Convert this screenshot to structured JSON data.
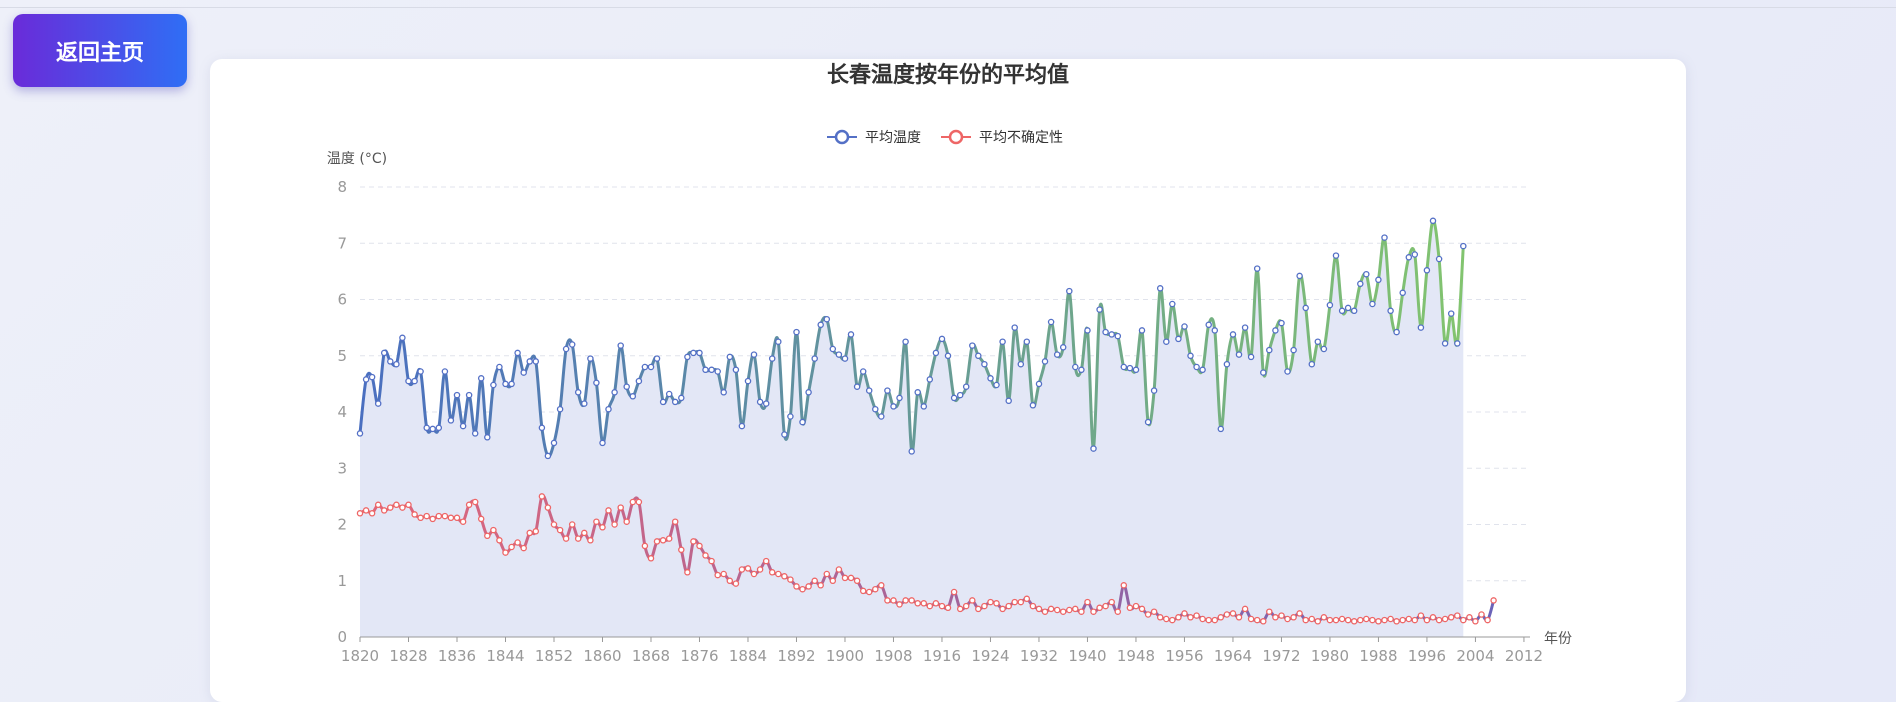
{
  "back_button": {
    "label": "返回主页"
  },
  "colors": {
    "temp_start": "#4a6fc0",
    "temp_end": "#82c46f",
    "unc_start": "#e0667a",
    "unc_end": "#6b63b8",
    "area": "#e3e7f6",
    "legend_temp": "#5470c6",
    "legend_unc": "#ee6666",
    "grid": "#e0e3ec"
  },
  "chart_data": {
    "type": "line",
    "title": "长春温度按年份的平均值",
    "ylabel": "温度 (°C)",
    "xlabel": "年份",
    "ylim": [
      0,
      8
    ],
    "yticks": [
      0,
      1,
      2,
      3,
      4,
      5,
      6,
      7,
      8
    ],
    "xlim": [
      1820,
      2013
    ],
    "xticks": [
      1820,
      1828,
      1836,
      1844,
      1852,
      1860,
      1868,
      1876,
      1884,
      1892,
      1900,
      1908,
      1916,
      1924,
      1932,
      1940,
      1948,
      1956,
      1964,
      1972,
      1980,
      1988,
      1996,
      2004,
      2012
    ],
    "grid": true,
    "legend_position": "top-center",
    "series": [
      {
        "name": "平均温度",
        "start_year": 1820,
        "values": [
          3.62,
          4.58,
          4.62,
          4.15,
          5.05,
          4.9,
          4.85,
          5.32,
          4.55,
          4.55,
          4.72,
          3.72,
          3.7,
          3.72,
          4.72,
          3.85,
          4.3,
          3.75,
          4.3,
          3.62,
          4.6,
          3.55,
          4.48,
          4.8,
          4.5,
          4.5,
          5.05,
          4.7,
          4.9,
          4.9,
          3.72,
          3.22,
          3.45,
          4.05,
          5.12,
          5.2,
          4.35,
          4.15,
          4.95,
          4.52,
          3.45,
          4.05,
          4.35,
          5.18,
          4.45,
          4.28,
          4.55,
          4.8,
          4.8,
          4.95,
          4.18,
          4.32,
          4.18,
          4.25,
          4.98,
          5.05,
          5.05,
          4.75,
          4.75,
          4.72,
          4.35,
          4.98,
          4.75,
          3.75,
          4.55,
          5.02,
          4.18,
          4.15,
          4.95,
          5.25,
          3.6,
          3.92,
          5.42,
          3.82,
          4.35,
          4.95,
          5.55,
          5.65,
          5.12,
          5.02,
          4.95,
          5.38,
          4.45,
          4.72,
          4.38,
          4.05,
          3.92,
          4.38,
          4.1,
          4.25,
          5.25,
          3.3,
          4.35,
          4.1,
          4.58,
          5.05,
          5.3,
          5.0,
          4.25,
          4.3,
          4.45,
          5.18,
          5.0,
          4.85,
          4.6,
          4.48,
          5.25,
          4.2,
          5.5,
          4.85,
          5.25,
          4.12,
          4.5,
          4.9,
          5.6,
          5.02,
          5.15,
          6.15,
          4.8,
          4.75,
          5.45,
          3.35,
          5.82,
          5.42,
          5.38,
          5.35,
          4.8,
          4.78,
          4.75,
          5.45,
          3.82,
          4.38,
          6.2,
          5.25,
          5.92,
          5.3,
          5.52,
          5.0,
          4.8,
          4.75,
          5.55,
          5.45,
          3.7,
          4.85,
          5.38,
          5.02,
          5.5,
          4.98,
          6.55,
          4.7,
          5.1,
          5.45,
          5.58,
          4.72,
          5.1,
          6.42,
          5.85,
          4.85,
          5.25,
          5.12,
          5.9,
          6.78,
          5.8,
          5.85,
          5.8,
          6.28,
          6.45,
          5.92,
          6.35,
          7.1,
          5.8,
          5.42,
          6.12,
          6.75,
          6.8,
          5.5,
          6.52,
          7.4,
          6.72,
          5.22,
          5.75,
          5.22,
          6.95
        ]
      },
      {
        "name": "平均不确定性",
        "start_year": 1820,
        "values": [
          2.2,
          2.25,
          2.2,
          2.35,
          2.25,
          2.3,
          2.35,
          2.3,
          2.35,
          2.18,
          2.12,
          2.15,
          2.1,
          2.15,
          2.15,
          2.12,
          2.12,
          2.05,
          2.35,
          2.4,
          2.1,
          1.8,
          1.9,
          1.72,
          1.5,
          1.6,
          1.68,
          1.58,
          1.85,
          1.88,
          2.5,
          2.3,
          2.0,
          1.9,
          1.75,
          2.0,
          1.75,
          1.85,
          1.72,
          2.05,
          1.95,
          2.25,
          2.0,
          2.3,
          2.05,
          2.4,
          2.4,
          1.62,
          1.4,
          1.7,
          1.72,
          1.75,
          2.05,
          1.55,
          1.15,
          1.7,
          1.62,
          1.45,
          1.35,
          1.1,
          1.12,
          1.0,
          0.95,
          1.2,
          1.22,
          1.12,
          1.2,
          1.35,
          1.15,
          1.12,
          1.08,
          1.02,
          0.9,
          0.85,
          0.9,
          1.0,
          0.92,
          1.12,
          1.0,
          1.2,
          1.05,
          1.05,
          1.0,
          0.82,
          0.8,
          0.85,
          0.92,
          0.65,
          0.65,
          0.58,
          0.65,
          0.65,
          0.6,
          0.6,
          0.55,
          0.6,
          0.55,
          0.52,
          0.8,
          0.5,
          0.55,
          0.65,
          0.5,
          0.55,
          0.62,
          0.6,
          0.5,
          0.55,
          0.62,
          0.62,
          0.68,
          0.55,
          0.5,
          0.45,
          0.5,
          0.48,
          0.45,
          0.48,
          0.5,
          0.45,
          0.62,
          0.45,
          0.52,
          0.55,
          0.62,
          0.45,
          0.92,
          0.52,
          0.55,
          0.5,
          0.4,
          0.45,
          0.35,
          0.32,
          0.3,
          0.35,
          0.42,
          0.35,
          0.38,
          0.32,
          0.3,
          0.3,
          0.35,
          0.4,
          0.42,
          0.35,
          0.5,
          0.32,
          0.3,
          0.28,
          0.45,
          0.35,
          0.38,
          0.32,
          0.35,
          0.42,
          0.3,
          0.32,
          0.28,
          0.35,
          0.3,
          0.3,
          0.32,
          0.3,
          0.28,
          0.3,
          0.32,
          0.3,
          0.28,
          0.3,
          0.32,
          0.28,
          0.3,
          0.32,
          0.3,
          0.38,
          0.3,
          0.35,
          0.3,
          0.32,
          0.35,
          0.38,
          0.3,
          0.35,
          0.28,
          0.4,
          0.3,
          0.65
        ]
      }
    ]
  }
}
